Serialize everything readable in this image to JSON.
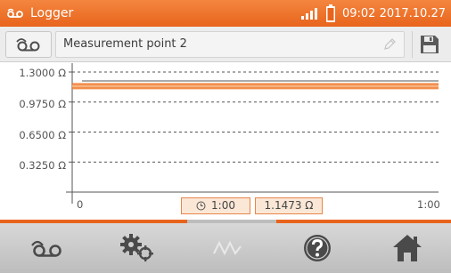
{
  "app": {
    "title": "Logger",
    "clock": "09:02 2017.10.27",
    "accent": "#e8641c"
  },
  "header": {
    "measurement_name": "Measurement point 2",
    "logger_icon": "logger-tape-icon",
    "edit_icon": "pencil-icon",
    "save_icon": "floppy-disk-icon"
  },
  "chart_data": {
    "type": "line",
    "y_ticks": [
      "1.3000 Ω",
      "0.9750 Ω",
      "0.6500 Ω",
      "0.3250 Ω"
    ],
    "y_tick_values": [
      1.3,
      0.975,
      0.65,
      0.325
    ],
    "ylim": [
      0,
      1.3
    ],
    "x_ticks": [
      "0",
      "1:00"
    ],
    "xlim": [
      0,
      1
    ],
    "grid": true,
    "series": [
      {
        "color": "#f07a2a",
        "x": [
          0,
          1
        ],
        "y": [
          1.1473,
          1.1473
        ]
      }
    ],
    "reference_line": {
      "color": "#555555",
      "y": 1.3
    },
    "cursor_time": "1:00",
    "cursor_value": "1.1473 Ω"
  },
  "nav": [
    {
      "icon": "logger-tape-icon",
      "enabled": true
    },
    {
      "icon": "gears-icon",
      "enabled": true
    },
    {
      "icon": "waveform-icon",
      "enabled": false
    },
    {
      "icon": "help-icon",
      "enabled": true
    },
    {
      "icon": "home-icon",
      "enabled": true
    }
  ]
}
